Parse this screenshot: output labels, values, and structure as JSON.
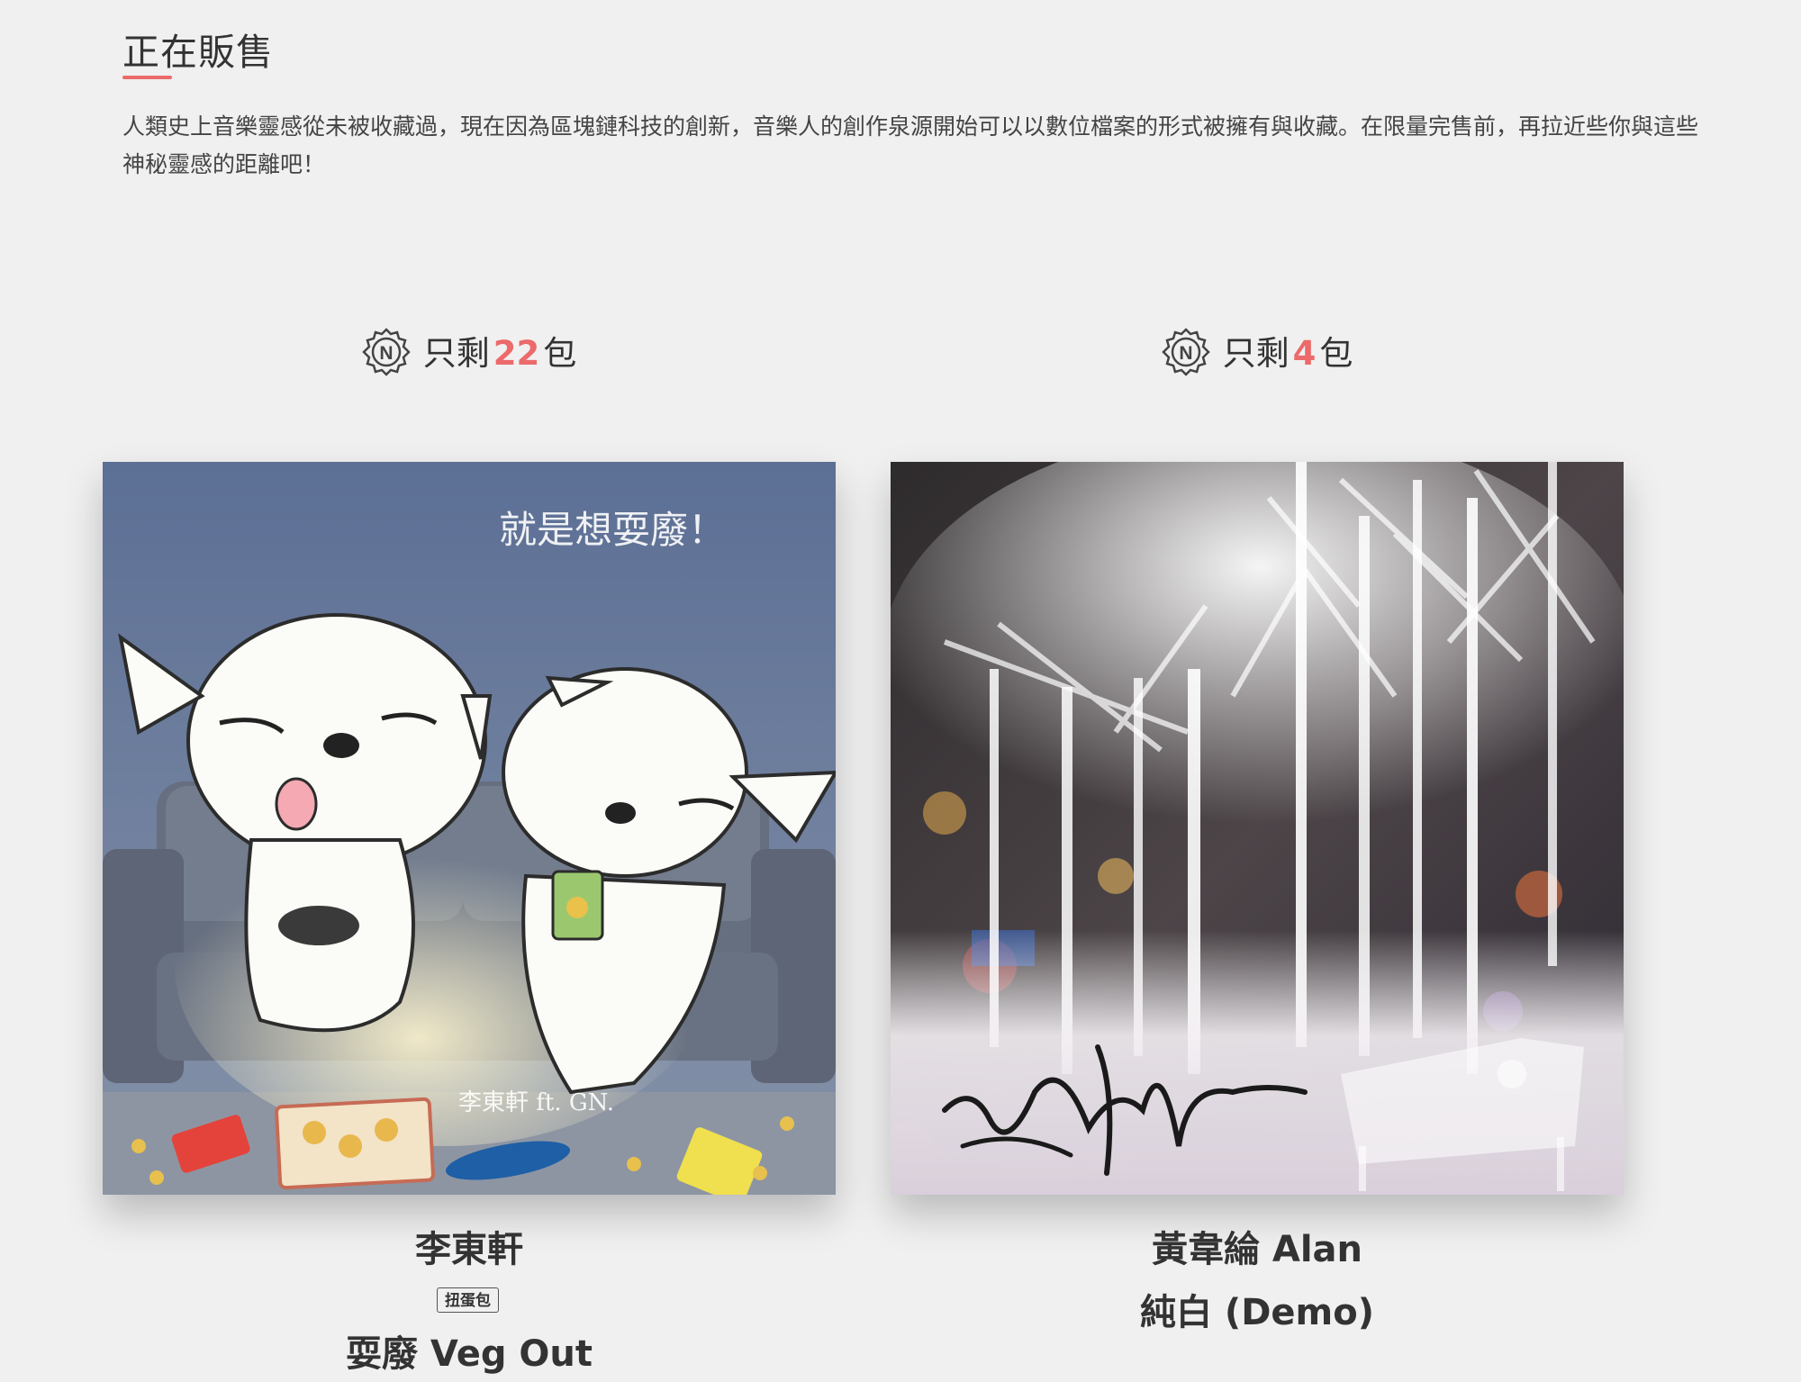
{
  "section": {
    "title": "正在販售",
    "description": "人類史上音樂靈感從未被收藏過，現在因為區塊鏈科技的創新，音樂人的創作泉源開始可以以數位檔案的形式被擁有與收藏。在限量完售前，再拉近些你與這些神秘靈感的距離吧！"
  },
  "colors": {
    "accent": "#ec6a6a",
    "background": "#f0f0f0",
    "text": "#333333"
  },
  "products": [
    {
      "stock_prefix": "只剩",
      "stock_count": "22",
      "stock_suffix": "包",
      "badge_icon": "n-badge-icon",
      "artist": "李東軒",
      "tag": "扭蛋包",
      "title": "耍廢 Veg Out",
      "cover_text": "就是想耍廢！",
      "cover_signature": "李東軒 ft. GN."
    },
    {
      "stock_prefix": "只剩",
      "stock_count": "4",
      "stock_suffix": "包",
      "badge_icon": "n-badge-icon",
      "artist": "黃韋綸 Alan",
      "title": "純白 (Demo)"
    }
  ]
}
